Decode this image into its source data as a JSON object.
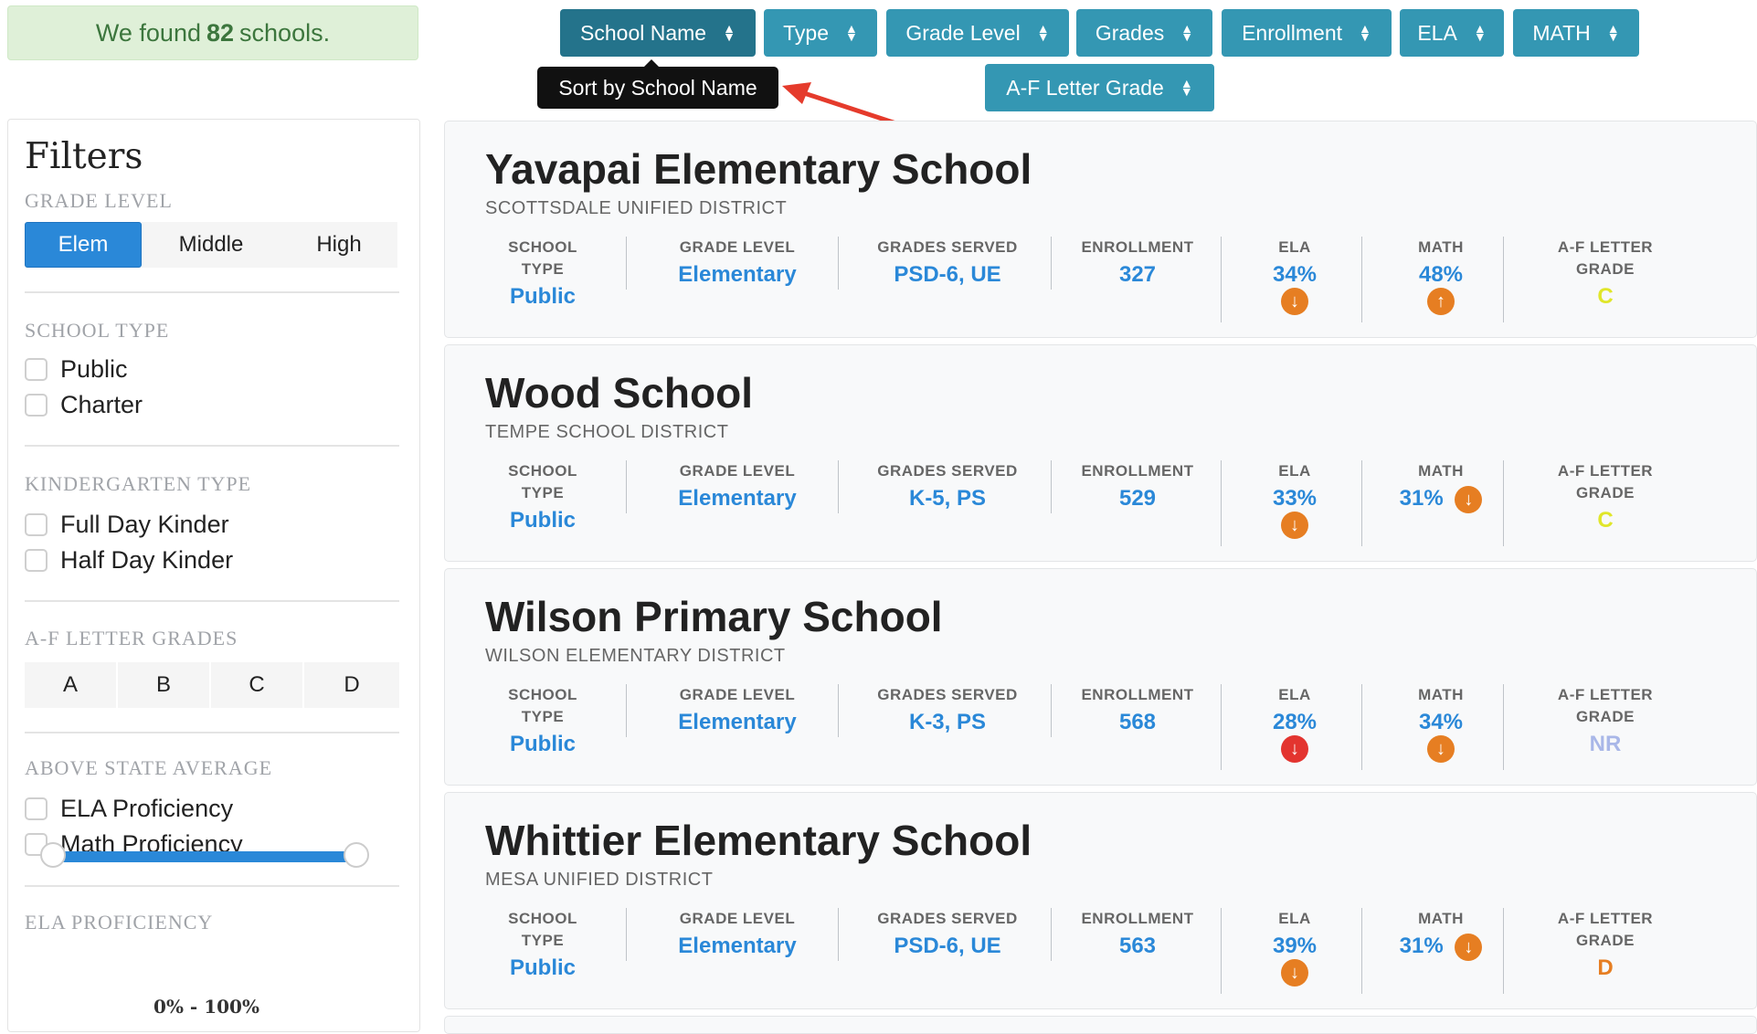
{
  "alert": {
    "prefix": "We found",
    "count": "82",
    "suffix": "schools."
  },
  "sort_buttons": [
    {
      "label": "School Name",
      "active": true
    },
    {
      "label": "Type"
    },
    {
      "label": "Grade Level"
    },
    {
      "label": "Grades"
    },
    {
      "label": "Enrollment"
    },
    {
      "label": "ELA"
    },
    {
      "label": "MATH"
    },
    {
      "label": "A-F Letter Grade"
    }
  ],
  "tooltip": "Sort by School Name",
  "filters": {
    "title": "Filters",
    "grade_level": {
      "title": "GRADE LEVEL",
      "options": [
        "Elem",
        "Middle",
        "High"
      ],
      "selected": "Elem"
    },
    "school_type": {
      "title": "SCHOOL TYPE",
      "options": [
        "Public",
        "Charter"
      ]
    },
    "kinder_type": {
      "title": "KINDERGARTEN TYPE",
      "options": [
        "Full Day Kinder",
        "Half Day Kinder"
      ]
    },
    "letter_grades": {
      "title": "A-F LETTER GRADES",
      "options": [
        "A",
        "B",
        "C",
        "D"
      ]
    },
    "above_state": {
      "title": "ABOVE STATE AVERAGE",
      "options": [
        "ELA Proficiency",
        "Math Proficiency"
      ]
    },
    "ela": {
      "title": "ELA PROFICIENCY",
      "range_label": "0% - 100%",
      "min": 0,
      "max": 100
    }
  },
  "columns": {
    "type": "SCHOOL TYPE",
    "grade_level": "GRADE LEVEL",
    "grades_served": "GRADES SERVED",
    "enrollment": "ENROLLMENT",
    "ela": "ELA",
    "math": "MATH",
    "letter_grade": "A-F LETTER GRADE"
  },
  "schools": [
    {
      "name": "Yavapai Elementary School",
      "district": "SCOTTSDALE UNIFIED DISTRICT",
      "type": "Public",
      "grade_level": "Elementary",
      "grades_served": "PSD-6, UE",
      "enrollment": "327",
      "ela": "34%",
      "ela_trend": "down",
      "ela_color": "#e67e22",
      "math": "48%",
      "math_trend": "up",
      "math_color": "#e67e22",
      "letter": "C",
      "letter_color": "#e0e62a"
    },
    {
      "name": "Wood School",
      "district": "TEMPE SCHOOL DISTRICT",
      "type": "Public",
      "grade_level": "Elementary",
      "grades_served": "K-5, PS",
      "enrollment": "529",
      "ela": "33%",
      "ela_trend": "down",
      "ela_color": "#e67e22",
      "math": "31%",
      "math_trend": "down",
      "math_color": "#e67e22",
      "letter": "C",
      "letter_color": "#e0e62a"
    },
    {
      "name": "Wilson Primary School",
      "district": "WILSON ELEMENTARY DISTRICT",
      "type": "Public",
      "grade_level": "Elementary",
      "grades_served": "K-3, PS",
      "enrollment": "568",
      "ela": "28%",
      "ela_trend": "down",
      "ela_color": "#e3342f",
      "math": "34%",
      "math_trend": "down",
      "math_color": "#e67e22",
      "letter": "NR",
      "letter_color": "#a9b7e8"
    },
    {
      "name": "Whittier Elementary School",
      "district": "MESA UNIFIED DISTRICT",
      "type": "Public",
      "grade_level": "Elementary",
      "grades_served": "PSD-6, UE",
      "enrollment": "563",
      "ela": "39%",
      "ela_trend": "down",
      "ela_color": "#e67e22",
      "math": "31%",
      "math_trend": "down",
      "math_color": "#e67e22",
      "letter": "D",
      "letter_color": "#e67e22"
    }
  ]
}
